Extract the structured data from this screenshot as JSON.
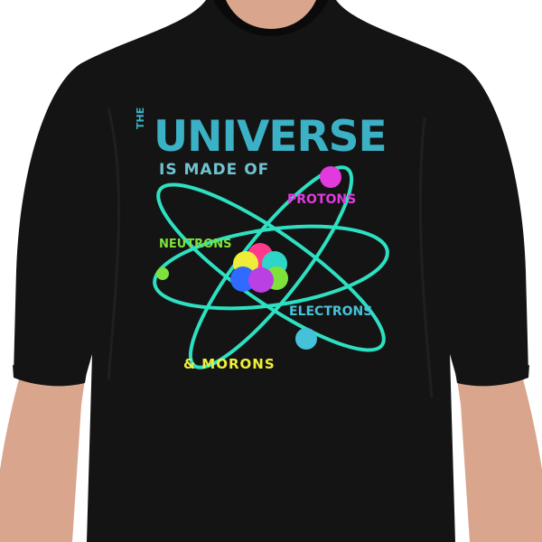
{
  "design": {
    "title_small": "THE",
    "title_big": "UNIVERSE",
    "subtitle": "IS MADE OF",
    "label_protons": "PROTONS",
    "label_neutrons": "NEUTRONS",
    "label_electrons": "ELECTRONS",
    "label_morons": "& MORONS"
  },
  "colors": {
    "shirt": "#141414",
    "title": "#3bb1c6",
    "subtitle": "#6fc3d1",
    "orbit": "#2ee0c2",
    "protons": "#e23adf",
    "neutrons": "#7ee23b",
    "electrons": "#46c2d8",
    "morons": "#f1ef3a",
    "nucleus": [
      "#ff3a8c",
      "#f0ed3a",
      "#2f6bff",
      "#7ee23b",
      "#bb3fe3",
      "#2ed6c9"
    ]
  }
}
